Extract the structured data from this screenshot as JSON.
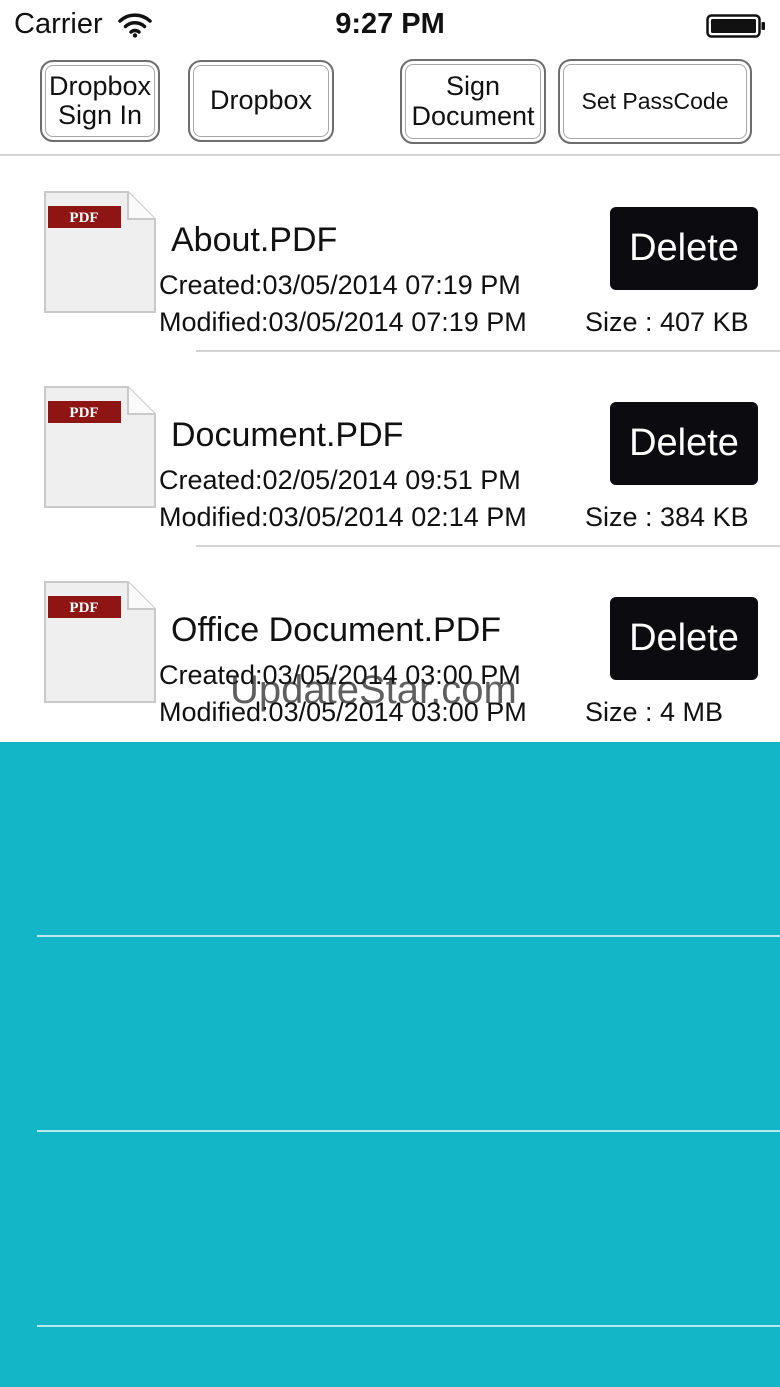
{
  "status_bar": {
    "carrier": "Carrier",
    "time": "9:27 PM",
    "wifi_icon": "wifi-icon",
    "battery_icon": "battery-icon"
  },
  "toolbar": {
    "dropbox_sign_in": "Dropbox Sign In",
    "dropbox": "Dropbox",
    "sign_document": "Sign Document",
    "set_passcode": "Set PassCode"
  },
  "files": [
    {
      "name": "About.PDF",
      "created": "Created:03/05/2014 07:19 PM",
      "modified": "Modified:03/05/2014 07:19 PM",
      "size": "Size : 407 KB",
      "delete_label": "Delete",
      "icon_label": "PDF"
    },
    {
      "name": "Document.PDF",
      "created": "Created:02/05/2014 09:51 PM",
      "modified": "Modified:03/05/2014 02:14 PM",
      "size": "Size : 384 KB",
      "delete_label": "Delete",
      "icon_label": "PDF"
    },
    {
      "name": "Office Document.PDF",
      "created": "Created:03/05/2014 03:00 PM",
      "modified": "Modified:03/05/2014 03:00 PM",
      "size": "Size : 4 MB",
      "delete_label": "Delete",
      "icon_label": "PDF"
    }
  ],
  "watermark": "UpdateStar.com",
  "colors": {
    "empty_area": "#12b6c7",
    "delete_button": "#0c0c10",
    "pdf_badge": "#8f1515"
  }
}
